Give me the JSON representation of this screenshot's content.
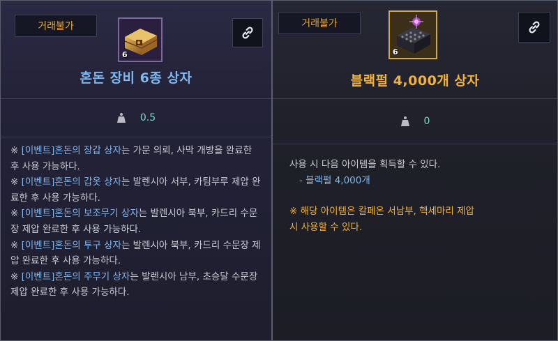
{
  "left_panel": {
    "badge": "거래불가",
    "icon": "equipment-chest-icon",
    "icon_count": "6",
    "title": "혼돈 장비 6종 상자",
    "weight": "0.5",
    "description": [
      {
        "prefix": "※ ",
        "item": "[이벤트]혼돈의 장갑 상자",
        "suffix": "는 가문 의뢰, 사막 개방을 완료한 후 사용 가능하다."
      },
      {
        "prefix": "※ ",
        "item": "[이벤트]혼돈의 갑옷 상자",
        "suffix": "는 발렌시아 서부, 카팀부루 제압 완료한 후 사용 가능하다."
      },
      {
        "prefix": "※ ",
        "item": "[이벤트]혼돈의 보조무기 상자",
        "suffix": "는 발렌시아 북부, 카드리 수문장 제압 완료한 후 사용 가능하다."
      },
      {
        "prefix": "※ ",
        "item": "[이벤트]혼돈의 투구 상자",
        "suffix": "는 발렌시아 북부, 카드리 수문장 제압 완료한 후 사용 가능하다."
      },
      {
        "prefix": "※ ",
        "item": "[이벤트]혼돈의 주무기 상자",
        "suffix": "는 발렌시아 남부, 초승달 수문장 제압 완료한 후 사용 가능하다."
      }
    ]
  },
  "right_panel": {
    "badge": "거래불가",
    "icon": "black-pearl-box-icon",
    "icon_count": "6",
    "title": "블랙펄 4,000개 상자",
    "weight": "0",
    "intro": "사용 시 다음 아이템을 획득할 수 있다.",
    "reward": "- 블랙펄 4,000개",
    "note_prefix": "※ 해당 아이템은 ",
    "note_highlight": "칼페온 서남부, 헥세마리 제압",
    "note_suffix": "시 사용할 수 있다."
  },
  "colors": {
    "badge_text": "#e3a73a",
    "title_blue": "#7fb7f0",
    "title_gold": "#f2b23c",
    "weight_text": "#7fd6c8"
  }
}
